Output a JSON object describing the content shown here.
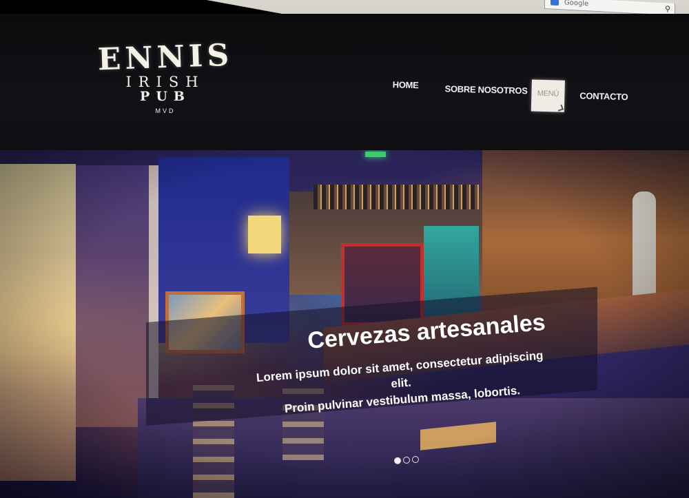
{
  "browser": {
    "search_placeholder": "Google"
  },
  "logo": {
    "line1": "ENNIS",
    "line2": "IRISH",
    "line3": "PUB",
    "line4": "MVD"
  },
  "nav": {
    "items": [
      {
        "label": "HOME"
      },
      {
        "label": "SOBRE NOSOTROS"
      },
      {
        "label": "MENÚ"
      },
      {
        "label": "CONTACTO"
      }
    ],
    "active_index": 2
  },
  "hero": {
    "title": "Cervezas artesanales",
    "text_line1": "Lorem ipsum dolor sit amet, consectetur adipiscing elit.",
    "text_line2": "Proin pulvinar vestibulum massa, lobortis.",
    "slide_count": 3,
    "active_slide": 1
  },
  "colors": {
    "header_bg": "#0e0d10",
    "menu_active_bg": "#efece6",
    "caption_bg": "#141028"
  }
}
